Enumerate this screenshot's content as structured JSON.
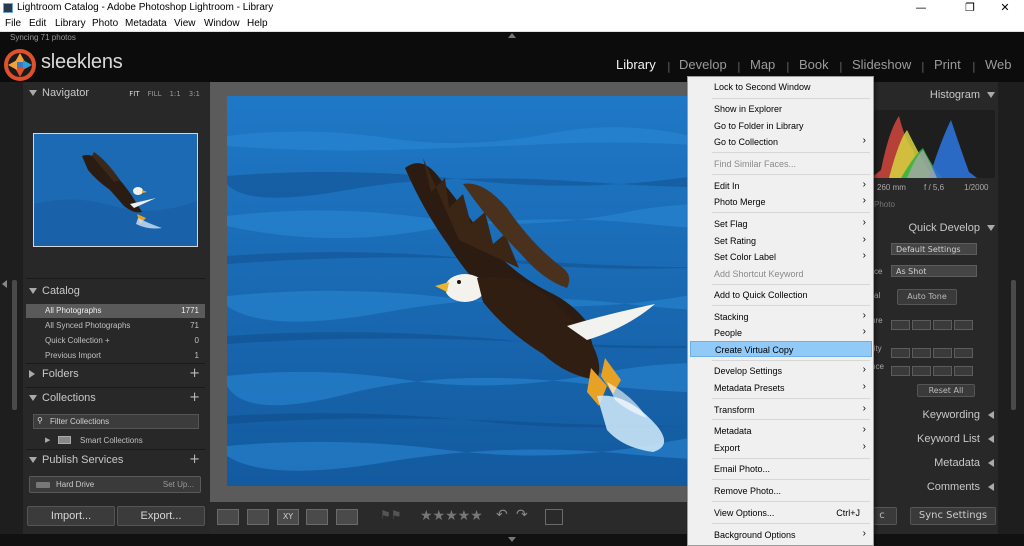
{
  "window": {
    "title": "Lightroom Catalog - Adobe Photoshop Lightroom - Library"
  },
  "menubar": [
    "File",
    "Edit",
    "Library",
    "Photo",
    "Metadata",
    "View",
    "Window",
    "Help"
  ],
  "identity": {
    "sync_status": "Syncing 71 photos",
    "brand": "sleeklens",
    "modules": [
      "Library",
      "Develop",
      "Map",
      "Book",
      "Slideshow",
      "Print",
      "Web"
    ],
    "active_module": "Library"
  },
  "left": {
    "navigator": {
      "title": "Navigator",
      "zoom_options": [
        "FIT",
        "FILL",
        "1:1",
        "3:1"
      ]
    },
    "catalog": {
      "title": "Catalog",
      "rows": [
        {
          "label": "All Photographs",
          "count": "1771"
        },
        {
          "label": "All Synced Photographs",
          "count": "71"
        },
        {
          "label": "Quick Collection +",
          "count": "0"
        },
        {
          "label": "Previous Import",
          "count": "1"
        }
      ]
    },
    "folders": {
      "title": "Folders"
    },
    "collections": {
      "title": "Collections",
      "filter_placeholder": "Filter Collections",
      "smart": "Smart Collections"
    },
    "publish": {
      "title": "Publish Services",
      "hard_drive": "Hard Drive",
      "setup": "Set Up..."
    },
    "import_label": "Import...",
    "export_label": "Export..."
  },
  "right": {
    "histogram": {
      "title": "Histogram",
      "focal": "260 mm",
      "aperture": "f / 5,6",
      "shutter": "1/2000",
      "photo_label": "Photo"
    },
    "quick_develop": {
      "title": "Quick Develop",
      "preset": "Default Settings",
      "wb_label": "ce",
      "wb": "As Shot",
      "tone_label": "al",
      "auto_tone": "Auto Tone",
      "labels": [
        "ure",
        "rity",
        "nce"
      ],
      "reset": "Reset All"
    },
    "keywording": "Keywording",
    "keyword_list": "Keyword List",
    "metadata": "Metadata",
    "comments": "Comments",
    "sync_settings": "Sync Settings",
    "sync_partial": "c"
  },
  "context_menu": {
    "items": [
      {
        "label": "Lock to Second Window",
        "arrow": "",
        "disabled": false
      },
      {
        "label": "Show in Explorer",
        "arrow": "",
        "disabled": false
      },
      {
        "label": "Go to Folder in Library",
        "arrow": "",
        "disabled": false
      },
      {
        "label": "Go to Collection",
        "arrow": "›",
        "disabled": false
      },
      {
        "label": "Find Similar Faces...",
        "arrow": "",
        "disabled": true
      },
      {
        "label": "Edit In",
        "arrow": "›",
        "disabled": false
      },
      {
        "label": "Photo Merge",
        "arrow": "›",
        "disabled": false
      },
      {
        "label": "Set Flag",
        "arrow": "›",
        "disabled": false
      },
      {
        "label": "Set Rating",
        "arrow": "›",
        "disabled": false
      },
      {
        "label": "Set Color Label",
        "arrow": "›",
        "disabled": false
      },
      {
        "label": "Add Shortcut Keyword",
        "arrow": "",
        "disabled": true
      },
      {
        "label": "Add to Quick Collection",
        "arrow": "",
        "disabled": false
      },
      {
        "label": "Stacking",
        "arrow": "›",
        "disabled": false
      },
      {
        "label": "People",
        "arrow": "›",
        "disabled": false
      },
      {
        "label": "Create Virtual Copy",
        "arrow": "",
        "disabled": false,
        "highlighted": true
      },
      {
        "label": "Develop Settings",
        "arrow": "›",
        "disabled": false
      },
      {
        "label": "Metadata Presets",
        "arrow": "›",
        "disabled": false
      },
      {
        "label": "Transform",
        "arrow": "›",
        "disabled": false
      },
      {
        "label": "Metadata",
        "arrow": "›",
        "disabled": false
      },
      {
        "label": "Export",
        "arrow": "›",
        "disabled": false
      },
      {
        "label": "Email Photo...",
        "arrow": "",
        "disabled": false
      },
      {
        "label": "Remove Photo...",
        "arrow": "",
        "disabled": false
      },
      {
        "label": "View Options...",
        "shortcut": "Ctrl+J",
        "arrow": "",
        "disabled": false
      },
      {
        "label": "Background Options",
        "arrow": "›",
        "disabled": false
      }
    ]
  },
  "toolbar": {
    "rating": "★★★★★"
  },
  "colors": {
    "accent": "#91c9f7",
    "water": "#1c6bb5",
    "panel": "#282828"
  }
}
